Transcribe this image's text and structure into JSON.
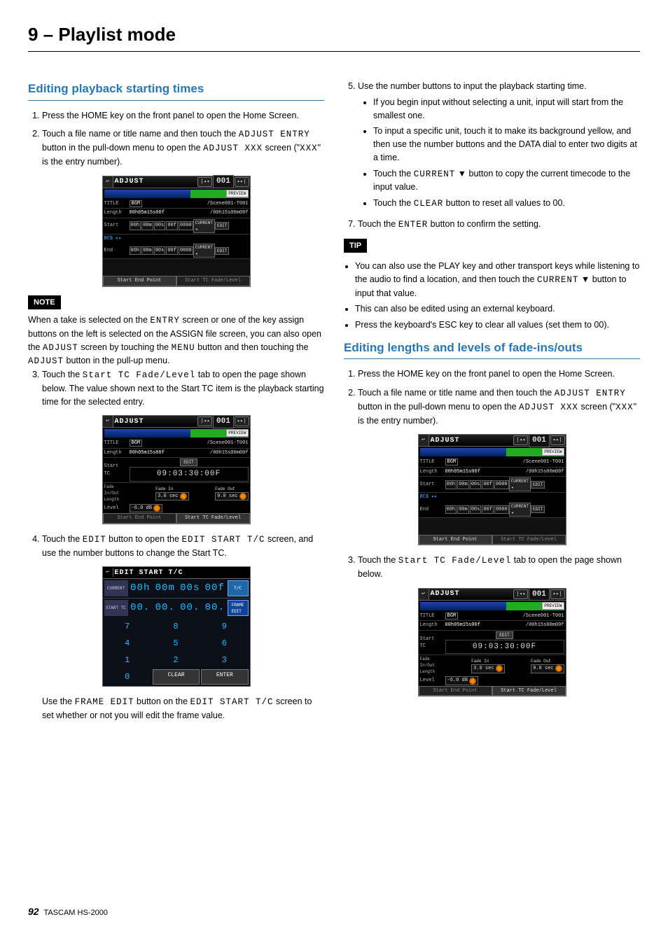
{
  "chapter": "9 – Playlist mode",
  "left": {
    "section_title": "Editing playback starting times",
    "step1": "Press the HOME key on the front panel to open the Home Screen.",
    "step2_a": "Touch a file name or title name and then touch the ",
    "step2_btn": "ADJUST ENTRY",
    "step2_b": " button in the pull-down menu to open the ",
    "step2_scr": "ADJUST XXX",
    "step2_c": " screen (\"",
    "step2_x": "XXX",
    "step2_d": "\" is the entry number).",
    "note_label": "NOTE",
    "note_a": "When a take is selected on the ",
    "note_entry": "ENTRY",
    "note_b": " screen or one of the key assign buttons on the left is selected on the ASSIGN file screen, you can also open the ",
    "note_adjust": "ADJUST",
    "note_c": " screen by touching the ",
    "note_menu": "MENU",
    "note_d": " button and then touching the ",
    "note_adjust2": "ADJUST",
    "note_e": " button in the pull-up menu.",
    "step3_a": "Touch the ",
    "step3_tab": "Start TC Fade/Level",
    "step3_b": " tab to open the page shown below. The value shown next to the Start TC item is the playback starting time for the selected entry.",
    "step4_a": "Touch the ",
    "step4_edit": "EDIT",
    "step4_b": " button to open the ",
    "step4_scr": "EDIT START T/C",
    "step4_c": " screen, and use the number buttons to change the Start TC.",
    "use_a": "Use the ",
    "use_btn": "FRAME EDIT",
    "use_b": " button on the ",
    "use_scr": "EDIT START T/C",
    "use_c": " screen to set whether or not you will edit the frame value."
  },
  "right": {
    "step5": "Use the number buttons to input the playback starting time.",
    "step5_b1": "If you begin input without selecting a unit, input will start from the smallest one.",
    "step5_b2": "To input a specific unit, touch it to make its background yellow, and then use the number buttons and the DATA dial to enter two digits at a time.",
    "step5_b3a": "Touch the ",
    "step5_b3btn": "CURRENT",
    "step5_b3b": " ▼ button to copy the current timecode to the input value.",
    "step5_b4a": "Touch the ",
    "step5_b4btn": "CLEAR",
    "step5_b4b": " button to reset all values to 00.",
    "step7_a": "Touch the ",
    "step7_btn": "ENTER",
    "step7_b": " button to confirm the setting.",
    "tip_label": "TIP",
    "tip1a": "You can also use the PLAY key and other transport keys while listening to the audio to find a location, and then touch the ",
    "tip1btn": "CURRENT",
    "tip1b": " ▼ button to input that value.",
    "tip2": "This can also be edited using an external keyboard.",
    "tip3": "Press the keyboard's ESC key to clear all values (set them to 00).",
    "section2": "Editing lengths and levels of fade-ins/outs",
    "s2_step1": "Press the HOME key on the front panel to open the Home Screen.",
    "s2_step2a": "Touch a file name or title name and then touch the ",
    "s2_step2btn": "ADJUST ENTRY",
    "s2_step2b": " button in the pull-down menu to open the ",
    "s2_step2scr": "ADJUST XXX",
    "s2_step2c": " screen (\"",
    "s2_step2x": "XXX",
    "s2_step2d": "\" is the entry number).",
    "s2_step3a": "Touch the ",
    "s2_step3tab": "Start TC Fade/Level",
    "s2_step3b": " tab to open the page shown below."
  },
  "adjust_screen": {
    "title": "ADJUST",
    "entry": "001",
    "preview": "PREVIEW",
    "title_lab": "TITLE",
    "title_val": "BGM",
    "title_right": "/Scene001-T001",
    "length_lab": "Length",
    "length_val": "00h05m15s00f",
    "length_right": "/00h15s00m00f",
    "start_lab": "Start",
    "end_lab": "End",
    "tc_cells": [
      "00h",
      "00m",
      "00s",
      "00f",
      "0000"
    ],
    "current": "CURRENT",
    "edit": "EDIT",
    "bcs": "BC$ ▸▸",
    "tab_left": "Start End Point",
    "tab_right": "Start TC\nFade/Level"
  },
  "adjust_screen2": {
    "starttc_lab": "Start\nTC",
    "edit_btn": "EDIT",
    "tc_value": "09:03:30:00F",
    "fade_lab": "Fade\nIn/Out\nLength",
    "fadein_lab": "Fade In",
    "fadein_val": "3.0 sec",
    "fadeout_lab": "Fade Out",
    "fadeout_val": "9.0 sec",
    "level_lab": "Level",
    "level_val": "-6.0 dB"
  },
  "edit_screen": {
    "title": "EDIT START T/C",
    "current_lab": "CURRENT",
    "starttc_lab": "START TC",
    "tc_side": "T/C",
    "frame_side": "FRAME\nEDIT",
    "seg": [
      "00h",
      "00m",
      "00s",
      "00f"
    ],
    "seg2": [
      "00.",
      "00.",
      "00.",
      "00."
    ],
    "keys": [
      "7",
      "8",
      "9",
      "4",
      "5",
      "6",
      "1",
      "2",
      "3",
      "0"
    ],
    "clear": "CLEAR",
    "enter": "ENTER"
  },
  "footer": {
    "page": "92",
    "model": "TASCAM  HS-2000"
  }
}
